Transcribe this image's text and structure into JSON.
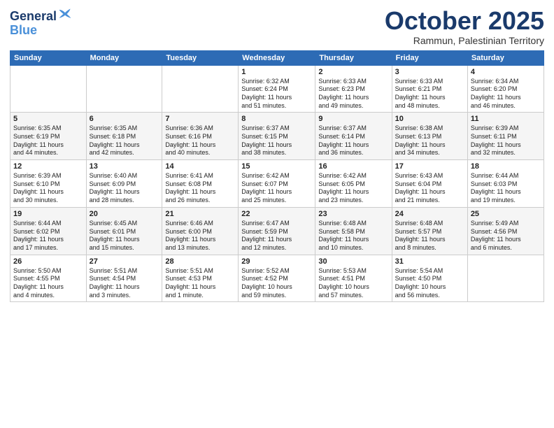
{
  "logo": {
    "line1": "General",
    "line2": "Blue"
  },
  "header": {
    "month": "October 2025",
    "location": "Rammun, Palestinian Territory"
  },
  "weekdays": [
    "Sunday",
    "Monday",
    "Tuesday",
    "Wednesday",
    "Thursday",
    "Friday",
    "Saturday"
  ],
  "weeks": [
    [
      {
        "day": "",
        "text": ""
      },
      {
        "day": "",
        "text": ""
      },
      {
        "day": "",
        "text": ""
      },
      {
        "day": "1",
        "text": "Sunrise: 6:32 AM\nSunset: 6:24 PM\nDaylight: 11 hours\nand 51 minutes."
      },
      {
        "day": "2",
        "text": "Sunrise: 6:33 AM\nSunset: 6:23 PM\nDaylight: 11 hours\nand 49 minutes."
      },
      {
        "day": "3",
        "text": "Sunrise: 6:33 AM\nSunset: 6:21 PM\nDaylight: 11 hours\nand 48 minutes."
      },
      {
        "day": "4",
        "text": "Sunrise: 6:34 AM\nSunset: 6:20 PM\nDaylight: 11 hours\nand 46 minutes."
      }
    ],
    [
      {
        "day": "5",
        "text": "Sunrise: 6:35 AM\nSunset: 6:19 PM\nDaylight: 11 hours\nand 44 minutes."
      },
      {
        "day": "6",
        "text": "Sunrise: 6:35 AM\nSunset: 6:18 PM\nDaylight: 11 hours\nand 42 minutes."
      },
      {
        "day": "7",
        "text": "Sunrise: 6:36 AM\nSunset: 6:16 PM\nDaylight: 11 hours\nand 40 minutes."
      },
      {
        "day": "8",
        "text": "Sunrise: 6:37 AM\nSunset: 6:15 PM\nDaylight: 11 hours\nand 38 minutes."
      },
      {
        "day": "9",
        "text": "Sunrise: 6:37 AM\nSunset: 6:14 PM\nDaylight: 11 hours\nand 36 minutes."
      },
      {
        "day": "10",
        "text": "Sunrise: 6:38 AM\nSunset: 6:13 PM\nDaylight: 11 hours\nand 34 minutes."
      },
      {
        "day": "11",
        "text": "Sunrise: 6:39 AM\nSunset: 6:11 PM\nDaylight: 11 hours\nand 32 minutes."
      }
    ],
    [
      {
        "day": "12",
        "text": "Sunrise: 6:39 AM\nSunset: 6:10 PM\nDaylight: 11 hours\nand 30 minutes."
      },
      {
        "day": "13",
        "text": "Sunrise: 6:40 AM\nSunset: 6:09 PM\nDaylight: 11 hours\nand 28 minutes."
      },
      {
        "day": "14",
        "text": "Sunrise: 6:41 AM\nSunset: 6:08 PM\nDaylight: 11 hours\nand 26 minutes."
      },
      {
        "day": "15",
        "text": "Sunrise: 6:42 AM\nSunset: 6:07 PM\nDaylight: 11 hours\nand 25 minutes."
      },
      {
        "day": "16",
        "text": "Sunrise: 6:42 AM\nSunset: 6:05 PM\nDaylight: 11 hours\nand 23 minutes."
      },
      {
        "day": "17",
        "text": "Sunrise: 6:43 AM\nSunset: 6:04 PM\nDaylight: 11 hours\nand 21 minutes."
      },
      {
        "day": "18",
        "text": "Sunrise: 6:44 AM\nSunset: 6:03 PM\nDaylight: 11 hours\nand 19 minutes."
      }
    ],
    [
      {
        "day": "19",
        "text": "Sunrise: 6:44 AM\nSunset: 6:02 PM\nDaylight: 11 hours\nand 17 minutes."
      },
      {
        "day": "20",
        "text": "Sunrise: 6:45 AM\nSunset: 6:01 PM\nDaylight: 11 hours\nand 15 minutes."
      },
      {
        "day": "21",
        "text": "Sunrise: 6:46 AM\nSunset: 6:00 PM\nDaylight: 11 hours\nand 13 minutes."
      },
      {
        "day": "22",
        "text": "Sunrise: 6:47 AM\nSunset: 5:59 PM\nDaylight: 11 hours\nand 12 minutes."
      },
      {
        "day": "23",
        "text": "Sunrise: 6:48 AM\nSunset: 5:58 PM\nDaylight: 11 hours\nand 10 minutes."
      },
      {
        "day": "24",
        "text": "Sunrise: 6:48 AM\nSunset: 5:57 PM\nDaylight: 11 hours\nand 8 minutes."
      },
      {
        "day": "25",
        "text": "Sunrise: 5:49 AM\nSunset: 4:56 PM\nDaylight: 11 hours\nand 6 minutes."
      }
    ],
    [
      {
        "day": "26",
        "text": "Sunrise: 5:50 AM\nSunset: 4:55 PM\nDaylight: 11 hours\nand 4 minutes."
      },
      {
        "day": "27",
        "text": "Sunrise: 5:51 AM\nSunset: 4:54 PM\nDaylight: 11 hours\nand 3 minutes."
      },
      {
        "day": "28",
        "text": "Sunrise: 5:51 AM\nSunset: 4:53 PM\nDaylight: 11 hours\nand 1 minute."
      },
      {
        "day": "29",
        "text": "Sunrise: 5:52 AM\nSunset: 4:52 PM\nDaylight: 10 hours\nand 59 minutes."
      },
      {
        "day": "30",
        "text": "Sunrise: 5:53 AM\nSunset: 4:51 PM\nDaylight: 10 hours\nand 57 minutes."
      },
      {
        "day": "31",
        "text": "Sunrise: 5:54 AM\nSunset: 4:50 PM\nDaylight: 10 hours\nand 56 minutes."
      },
      {
        "day": "",
        "text": ""
      }
    ]
  ]
}
